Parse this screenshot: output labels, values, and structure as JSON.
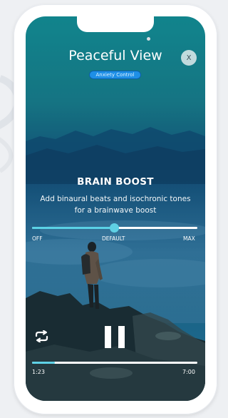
{
  "header": {
    "title": "Peaceful View",
    "badge": "Anxiety Control",
    "close_label": "X"
  },
  "brain_boost": {
    "title": "BRAIN BOOST",
    "description": "Add binaural beats and isochronic tones for a brainwave boost",
    "level": 0.5,
    "labels": {
      "off": "OFF",
      "default": "DEFAULT",
      "max": "MAX"
    }
  },
  "player": {
    "elapsed": "1:23",
    "duration": "7:00",
    "progress": 0.14,
    "state": "playing",
    "icons": [
      "repeat-icon",
      "pause-icon",
      "close-icon"
    ]
  },
  "colors": {
    "accent": "#5fd0e4",
    "badge": "#1e8fe6"
  }
}
